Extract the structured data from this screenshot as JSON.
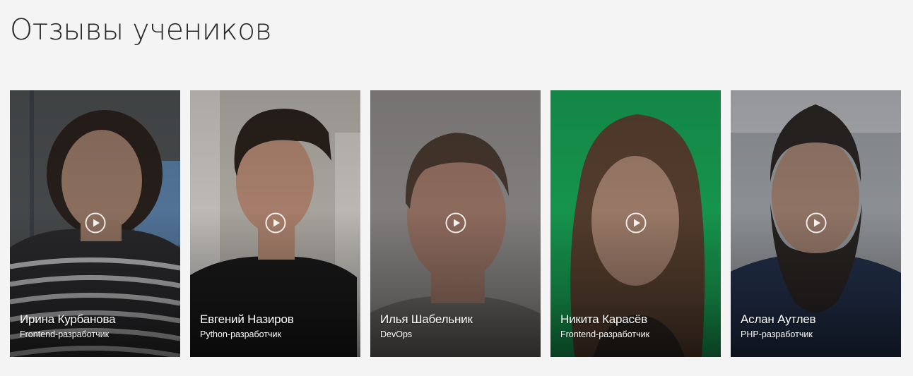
{
  "section": {
    "title": "Отзывы учеников"
  },
  "reviews": [
    {
      "name": "Ирина Курбанова",
      "role": "Frontend-разработчик",
      "play_icon": "play-icon",
      "colors": {
        "bg": "#4d5052",
        "shirt": "#2c2b2e",
        "skin": "#9a7a68",
        "hair": "#2a211d"
      }
    },
    {
      "name": "Евгений Назиров",
      "role": "Python-разработчик",
      "play_icon": "play-icon",
      "colors": {
        "bg": "#b9b5ae",
        "shirt": "#1b1a1a",
        "skin": "#b88b76",
        "hair": "#2b221c"
      }
    },
    {
      "name": "Илья Шабельник",
      "role": "DevOps",
      "play_icon": "play-icon",
      "colors": {
        "bg": "#8f8c8b",
        "shirt": "#6e6b69",
        "skin": "#9c7667",
        "hair": "#4a3a30"
      }
    },
    {
      "name": "Никита Карасёв",
      "role": "Frontend-разработчик",
      "play_icon": "play-icon",
      "colors": {
        "bg": "#18a455",
        "shirt": "#2f2824",
        "skin": "#a98571",
        "hair": "#5b4231"
      }
    },
    {
      "name": "Аслан Аутлев",
      "role": "PHP-разработчик",
      "play_icon": "play-icon",
      "colors": {
        "bg": "#9b9ea3",
        "shirt": "#24324d",
        "skin": "#9f8070",
        "hair": "#2a2624"
      }
    }
  ]
}
